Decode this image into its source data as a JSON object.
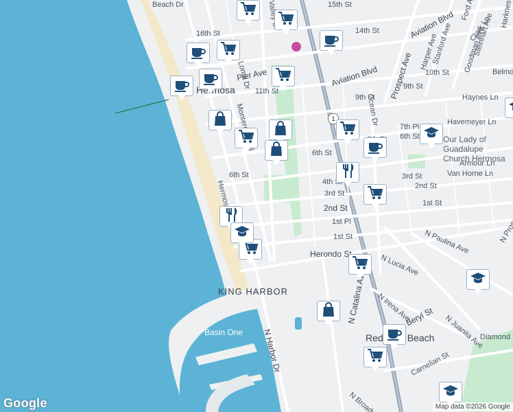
{
  "map": {
    "title": "",
    "water_labels": [
      "Basin One"
    ],
    "area_labels": [
      "KING HARBOR",
      "Redondo Beach",
      "Hermosa"
    ],
    "poi_labels": [
      "Our Lady of Guadalupe Church Hermosa"
    ],
    "streets": [
      "Beach Dr",
      "16th St",
      "15th St",
      "14th St",
      "Pier Ave",
      "Loma Dr",
      "Monterey Blvd",
      "Valley Dr",
      "Aviation Blvd",
      "11th St",
      "10th St",
      "9th St",
      "Ocean Dr",
      "Prospect Ave",
      "Harper Ave",
      "Stanford Ave",
      "Goodman Ave",
      "Steinhart Ave",
      "Clark Ln",
      "Ford Ave",
      "Harkness Ln",
      "Belmont Ln",
      "Haynes Ln",
      "Havemeyer Ln",
      "7th Pl",
      "6th St",
      "Armour Ln",
      "Van Horne Ln",
      "4th St",
      "3rd St",
      "2nd St",
      "1st St",
      "1st Pl",
      "Herondo St",
      "Hermosa Ave",
      "N Paulina Ave",
      "N Lucia Ave",
      "N Irena Ave",
      "N Juanita Ave",
      "Beryl St",
      "N Catalina Ave",
      "N Harbor Dr",
      "Carnelian St",
      "N Broadway",
      "N Prospect Ave",
      "Diamond St"
    ],
    "highway_shield": "1",
    "attribution": "Map data ©2026 Google",
    "logo": "Google",
    "colors": {
      "ocean": "#5cb3d6",
      "beach": "#f3e8c7",
      "land": "#eef0f2",
      "road": "#ffffff",
      "highway": "#8fa1b4",
      "park": "#c8ebd0",
      "pin_icon": "#1f4e79"
    },
    "markers": [
      {
        "icon": "coffee-icon"
      },
      {
        "icon": "coffee-icon"
      },
      {
        "icon": "coffee-icon"
      },
      {
        "icon": "coffee-icon"
      },
      {
        "icon": "coffee-icon"
      },
      {
        "icon": "coffee-icon"
      },
      {
        "icon": "cart-icon"
      },
      {
        "icon": "cart-icon"
      },
      {
        "icon": "cart-icon"
      },
      {
        "icon": "cart-icon"
      },
      {
        "icon": "cart-icon"
      },
      {
        "icon": "cart-icon"
      },
      {
        "icon": "cart-icon"
      },
      {
        "icon": "cart-icon"
      },
      {
        "icon": "cart-icon"
      },
      {
        "icon": "cart-icon"
      },
      {
        "icon": "bag-icon"
      },
      {
        "icon": "bag-icon"
      },
      {
        "icon": "bag-icon"
      },
      {
        "icon": "bag-icon"
      },
      {
        "icon": "fork-knife-icon"
      },
      {
        "icon": "fork-knife-icon"
      },
      {
        "icon": "school-icon"
      },
      {
        "icon": "school-icon"
      },
      {
        "icon": "school-icon"
      },
      {
        "icon": "school-icon"
      },
      {
        "icon": "school-icon"
      }
    ]
  }
}
